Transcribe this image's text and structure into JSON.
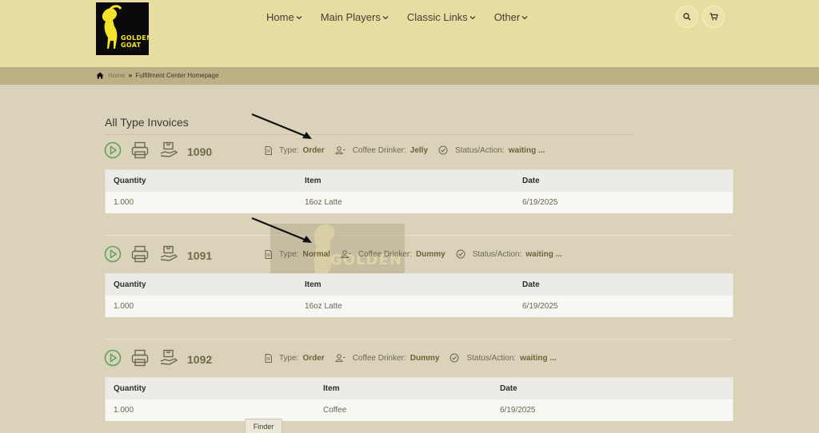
{
  "logo": {
    "line1": "GOLDEN",
    "line2": "GOAT"
  },
  "nav": [
    {
      "label": "Home"
    },
    {
      "label": "Main Players"
    },
    {
      "label": "Classic Links"
    },
    {
      "label": "Other"
    }
  ],
  "breadcrumb": {
    "home": "Home",
    "current": "Fulfillment Center Homepage"
  },
  "page": {
    "title": "All Type Invoices"
  },
  "labels": {
    "type": "Type:",
    "drinker": "Coffee Drinker:",
    "status": "Status/Action:"
  },
  "table_headers": {
    "quantity": "Quantity",
    "item": "Item",
    "date": "Date"
  },
  "invoices": [
    {
      "number": "1090",
      "type": "Order",
      "drinker": "Jelly",
      "status": "waiting ...",
      "quantity": "1.000",
      "item": "16oz Latte",
      "date": "6/19/2025"
    },
    {
      "number": "1091",
      "type": "Normal",
      "drinker": "Dummy",
      "status": "waiting ...",
      "quantity": "1.000",
      "item": "16oz Latte",
      "date": "6/19/2025"
    },
    {
      "number": "1092",
      "type": "Order",
      "drinker": "Dummy",
      "status": "waiting ...",
      "quantity": "1.000",
      "item": "Coffee",
      "date": "6/19/2025"
    }
  ],
  "watermark": {
    "text": "GOLDEN"
  },
  "finder": {
    "label": "Finder"
  },
  "colors": {
    "header": "#e8dda1",
    "breadcrumb": "#bdb085",
    "body": "#dad3ba",
    "accent_green": "#5aa05a"
  }
}
